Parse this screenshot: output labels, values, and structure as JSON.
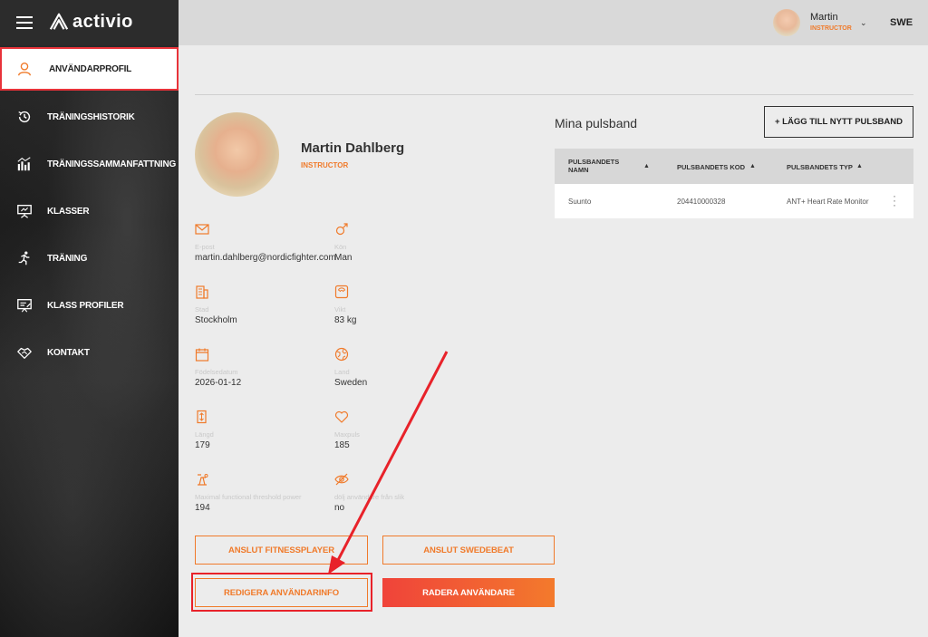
{
  "brand": {
    "name": "activio"
  },
  "sidebar": {
    "items": [
      {
        "label": "ANVÄNDARPROFIL",
        "icon": "user-icon"
      },
      {
        "label": "TRÄNINGSHISTORIK",
        "icon": "history-icon"
      },
      {
        "label": "TRÄNINGSSAMMANFATTNING",
        "icon": "chart-icon"
      },
      {
        "label": "KLASSER",
        "icon": "presentation-icon"
      },
      {
        "label": "TRÄNING",
        "icon": "running-icon"
      },
      {
        "label": "KLASS PROFILER",
        "icon": "class-profile-icon"
      },
      {
        "label": "KONTAKT",
        "icon": "handshake-icon"
      }
    ]
  },
  "header": {
    "user_name": "Martin",
    "user_role": "INSTRUCTOR",
    "language": "SWE"
  },
  "profile": {
    "name": "Martin Dahlberg",
    "role": "INSTRUCTOR",
    "fields": [
      {
        "label": "E-post",
        "value": "martin.dahlberg@nordicfighter.com",
        "icon": "envelope-icon"
      },
      {
        "label": "Kön",
        "value": "Man",
        "icon": "gender-icon"
      },
      {
        "label": "Stad",
        "value": "Stockholm",
        "icon": "building-icon"
      },
      {
        "label": "Vikt",
        "value": "83 kg",
        "icon": "scale-icon"
      },
      {
        "label": "Födelsedatum",
        "value": "2026-01-12",
        "icon": "calendar-icon"
      },
      {
        "label": "Land",
        "value": "Sweden",
        "icon": "globe-icon"
      },
      {
        "label": "Längd",
        "value": "179",
        "icon": "height-icon"
      },
      {
        "label": "Maxpuls",
        "value": "185",
        "icon": "heart-icon"
      },
      {
        "label": "Maximal functional threshold power",
        "value": "194",
        "icon": "bike-icon"
      },
      {
        "label": "dölj användare från slik",
        "value": "no",
        "icon": "eye-off-icon"
      }
    ]
  },
  "buttons": {
    "connect_fitnessplayer": "ANSLUT FITNESSPLAYER",
    "connect_swedebeat": "ANSLUT SWEDEBEAT",
    "edit_user": "REDIGERA ANVÄNDARINFO",
    "delete_user": "RADERA ANVÄNDARE"
  },
  "pulsband": {
    "title": "Mina pulsband",
    "add_button": "+ LÄGG TILL NYTT PULSBAND",
    "columns": [
      "PULSBANDETS NAMN",
      "PULSBANDETS KOD",
      "PULSBANDETS TYP"
    ],
    "sort_glyph": "▲",
    "rows": [
      {
        "name": "Suunto",
        "code": "204410000328",
        "type": "ANT+ Heart Rate Monitor"
      }
    ]
  },
  "colors": {
    "accent": "#f07a2a",
    "danger_start": "#f0433a",
    "annotation": "#e8222a"
  }
}
